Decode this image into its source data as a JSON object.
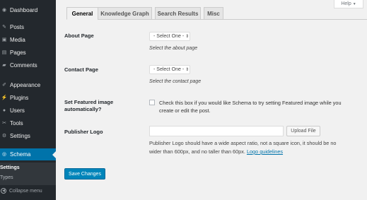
{
  "sidebar": {
    "items": [
      {
        "label": "Dashboard",
        "icon": "dashboard-icon",
        "glyph": "◉"
      },
      {
        "label": "Posts",
        "icon": "pin-icon",
        "glyph": "✎"
      },
      {
        "label": "Media",
        "icon": "media-icon",
        "glyph": "▣"
      },
      {
        "label": "Pages",
        "icon": "pages-icon",
        "glyph": "▤"
      },
      {
        "label": "Comments",
        "icon": "comments-icon",
        "glyph": "▰"
      },
      {
        "label": "Appearance",
        "icon": "brush-icon",
        "glyph": "✐"
      },
      {
        "label": "Plugins",
        "icon": "plugin-icon",
        "glyph": "⚡"
      },
      {
        "label": "Users",
        "icon": "users-icon",
        "glyph": "●"
      },
      {
        "label": "Tools",
        "icon": "wrench-icon",
        "glyph": "✂"
      },
      {
        "label": "Settings",
        "icon": "settings-icon",
        "glyph": "⚙"
      },
      {
        "label": "Schema",
        "icon": "schema-icon",
        "glyph": "◎",
        "active": true
      }
    ],
    "submenu": [
      {
        "label": "Settings",
        "current": true
      },
      {
        "label": "Types",
        "current": false
      }
    ],
    "collapse_label": "Collapse menu",
    "colors": {
      "background": "#23282d",
      "active": "#0073aa"
    }
  },
  "help": {
    "label": "Help",
    "arrow": "▼"
  },
  "tabs": [
    "General",
    "Knowledge Graph",
    "Search Results",
    "Misc"
  ],
  "active_tab": "General",
  "form": {
    "about_page": {
      "label": "About Page",
      "select_value": "- Select One -",
      "select_arrow": "⇕",
      "description": "Select the about page"
    },
    "contact_page": {
      "label": "Contact Page",
      "select_value": "- Select One -",
      "select_arrow": "⇕",
      "description": "Select the contact page"
    },
    "featured_image": {
      "label_line1": "Set Featured image",
      "label_line2": "automatically?",
      "checked": false,
      "text_line1": "Check this box if you would like Schema to try setting Featured image while you",
      "text_line2": "create or edit the post."
    },
    "publisher_logo": {
      "label": "Publisher Logo",
      "value": "",
      "upload_label": "Upload File",
      "desc_line1": "Publisher Logo should have a wide aspect ratio, not a square icon, it should be no",
      "desc_line2_prefix": "wider than 600px, and no taller than 60px.",
      "link_text": "Logo guidelines"
    }
  },
  "save_label": "Save Changes",
  "colors": {
    "button": "#0085ba",
    "link": "#0073aa",
    "page_bg": "#f1f1f1"
  }
}
